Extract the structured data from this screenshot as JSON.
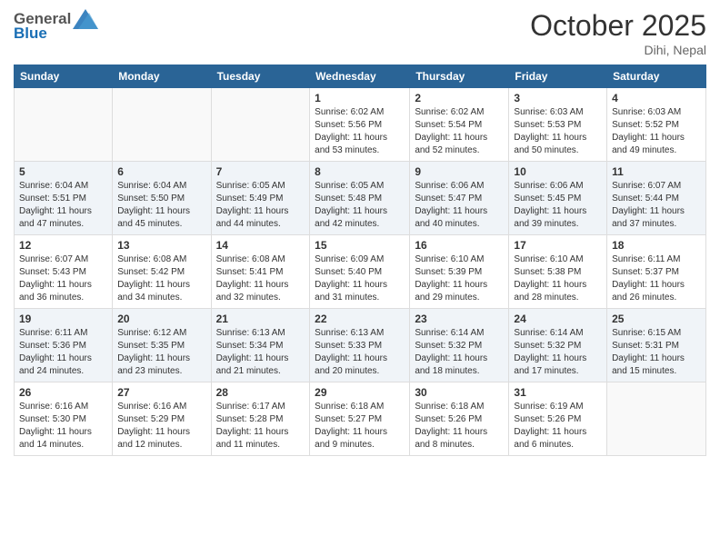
{
  "header": {
    "logo_general": "General",
    "logo_blue": "Blue",
    "month": "October 2025",
    "location": "Dihi, Nepal"
  },
  "weekdays": [
    "Sunday",
    "Monday",
    "Tuesday",
    "Wednesday",
    "Thursday",
    "Friday",
    "Saturday"
  ],
  "weeks": [
    [
      {
        "day": "",
        "content": ""
      },
      {
        "day": "",
        "content": ""
      },
      {
        "day": "",
        "content": ""
      },
      {
        "day": "1",
        "content": "Sunrise: 6:02 AM\nSunset: 5:56 PM\nDaylight: 11 hours\nand 53 minutes."
      },
      {
        "day": "2",
        "content": "Sunrise: 6:02 AM\nSunset: 5:54 PM\nDaylight: 11 hours\nand 52 minutes."
      },
      {
        "day": "3",
        "content": "Sunrise: 6:03 AM\nSunset: 5:53 PM\nDaylight: 11 hours\nand 50 minutes."
      },
      {
        "day": "4",
        "content": "Sunrise: 6:03 AM\nSunset: 5:52 PM\nDaylight: 11 hours\nand 49 minutes."
      }
    ],
    [
      {
        "day": "5",
        "content": "Sunrise: 6:04 AM\nSunset: 5:51 PM\nDaylight: 11 hours\nand 47 minutes."
      },
      {
        "day": "6",
        "content": "Sunrise: 6:04 AM\nSunset: 5:50 PM\nDaylight: 11 hours\nand 45 minutes."
      },
      {
        "day": "7",
        "content": "Sunrise: 6:05 AM\nSunset: 5:49 PM\nDaylight: 11 hours\nand 44 minutes."
      },
      {
        "day": "8",
        "content": "Sunrise: 6:05 AM\nSunset: 5:48 PM\nDaylight: 11 hours\nand 42 minutes."
      },
      {
        "day": "9",
        "content": "Sunrise: 6:06 AM\nSunset: 5:47 PM\nDaylight: 11 hours\nand 40 minutes."
      },
      {
        "day": "10",
        "content": "Sunrise: 6:06 AM\nSunset: 5:45 PM\nDaylight: 11 hours\nand 39 minutes."
      },
      {
        "day": "11",
        "content": "Sunrise: 6:07 AM\nSunset: 5:44 PM\nDaylight: 11 hours\nand 37 minutes."
      }
    ],
    [
      {
        "day": "12",
        "content": "Sunrise: 6:07 AM\nSunset: 5:43 PM\nDaylight: 11 hours\nand 36 minutes."
      },
      {
        "day": "13",
        "content": "Sunrise: 6:08 AM\nSunset: 5:42 PM\nDaylight: 11 hours\nand 34 minutes."
      },
      {
        "day": "14",
        "content": "Sunrise: 6:08 AM\nSunset: 5:41 PM\nDaylight: 11 hours\nand 32 minutes."
      },
      {
        "day": "15",
        "content": "Sunrise: 6:09 AM\nSunset: 5:40 PM\nDaylight: 11 hours\nand 31 minutes."
      },
      {
        "day": "16",
        "content": "Sunrise: 6:10 AM\nSunset: 5:39 PM\nDaylight: 11 hours\nand 29 minutes."
      },
      {
        "day": "17",
        "content": "Sunrise: 6:10 AM\nSunset: 5:38 PM\nDaylight: 11 hours\nand 28 minutes."
      },
      {
        "day": "18",
        "content": "Sunrise: 6:11 AM\nSunset: 5:37 PM\nDaylight: 11 hours\nand 26 minutes."
      }
    ],
    [
      {
        "day": "19",
        "content": "Sunrise: 6:11 AM\nSunset: 5:36 PM\nDaylight: 11 hours\nand 24 minutes."
      },
      {
        "day": "20",
        "content": "Sunrise: 6:12 AM\nSunset: 5:35 PM\nDaylight: 11 hours\nand 23 minutes."
      },
      {
        "day": "21",
        "content": "Sunrise: 6:13 AM\nSunset: 5:34 PM\nDaylight: 11 hours\nand 21 minutes."
      },
      {
        "day": "22",
        "content": "Sunrise: 6:13 AM\nSunset: 5:33 PM\nDaylight: 11 hours\nand 20 minutes."
      },
      {
        "day": "23",
        "content": "Sunrise: 6:14 AM\nSunset: 5:32 PM\nDaylight: 11 hours\nand 18 minutes."
      },
      {
        "day": "24",
        "content": "Sunrise: 6:14 AM\nSunset: 5:32 PM\nDaylight: 11 hours\nand 17 minutes."
      },
      {
        "day": "25",
        "content": "Sunrise: 6:15 AM\nSunset: 5:31 PM\nDaylight: 11 hours\nand 15 minutes."
      }
    ],
    [
      {
        "day": "26",
        "content": "Sunrise: 6:16 AM\nSunset: 5:30 PM\nDaylight: 11 hours\nand 14 minutes."
      },
      {
        "day": "27",
        "content": "Sunrise: 6:16 AM\nSunset: 5:29 PM\nDaylight: 11 hours\nand 12 minutes."
      },
      {
        "day": "28",
        "content": "Sunrise: 6:17 AM\nSunset: 5:28 PM\nDaylight: 11 hours\nand 11 minutes."
      },
      {
        "day": "29",
        "content": "Sunrise: 6:18 AM\nSunset: 5:27 PM\nDaylight: 11 hours\nand 9 minutes."
      },
      {
        "day": "30",
        "content": "Sunrise: 6:18 AM\nSunset: 5:26 PM\nDaylight: 11 hours\nand 8 minutes."
      },
      {
        "day": "31",
        "content": "Sunrise: 6:19 AM\nSunset: 5:26 PM\nDaylight: 11 hours\nand 6 minutes."
      },
      {
        "day": "",
        "content": ""
      }
    ]
  ]
}
